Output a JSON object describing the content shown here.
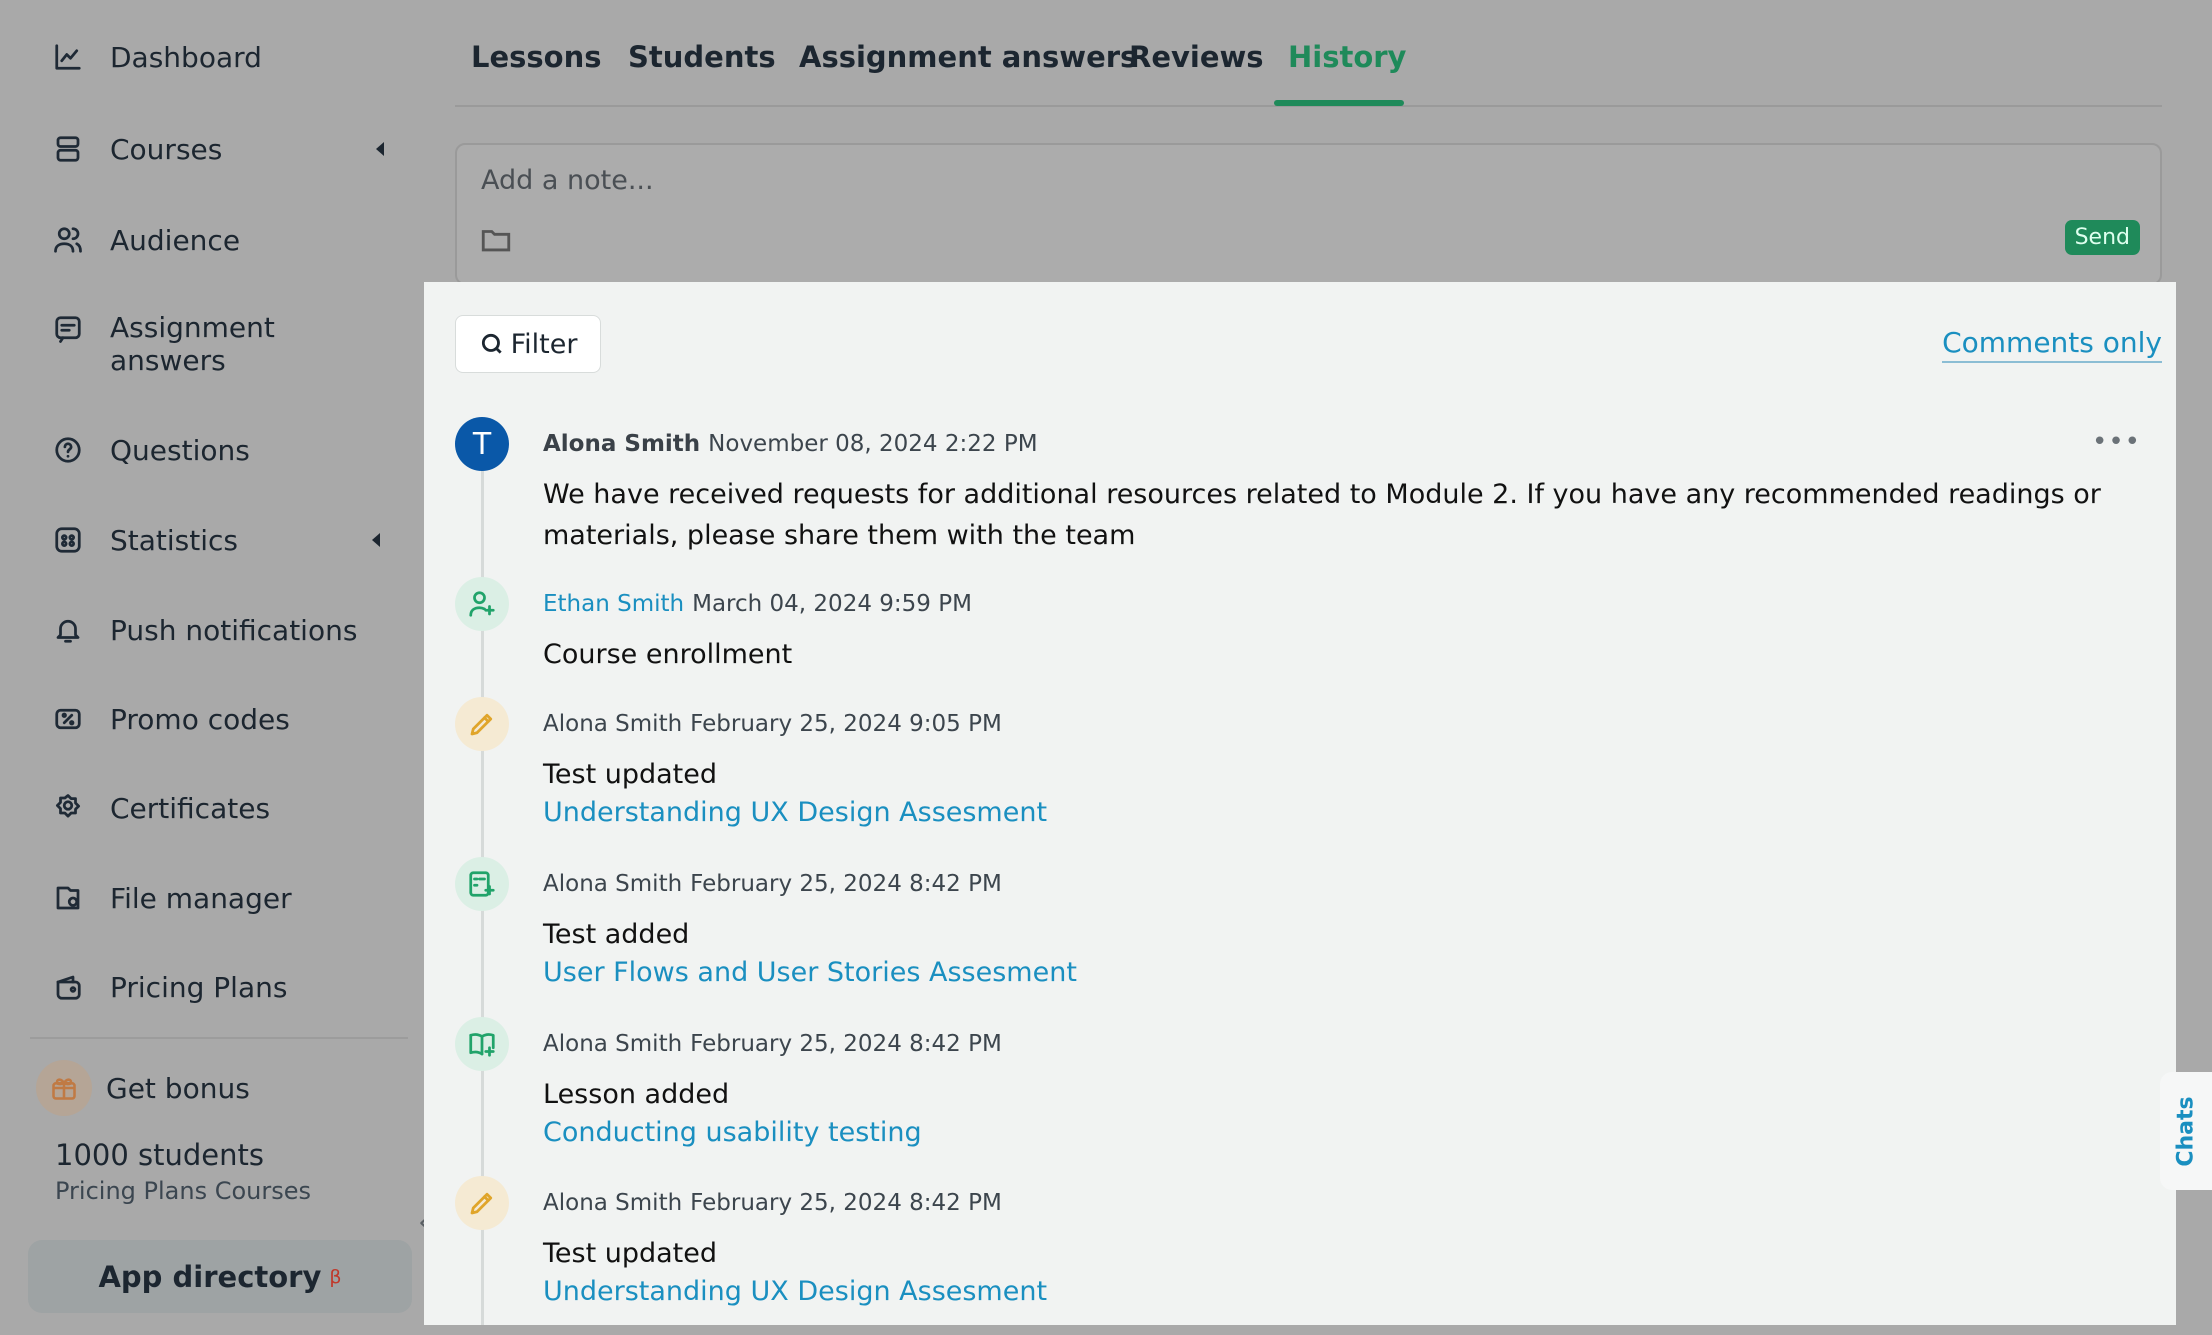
{
  "sidebar": {
    "items": [
      {
        "label": "Dashboard",
        "icon": "chart-line-icon"
      },
      {
        "label": "Courses",
        "icon": "stack-icon"
      },
      {
        "label": "Audience",
        "icon": "users-icon"
      },
      {
        "label": "Assignment answers",
        "icon": "assignment-icon"
      },
      {
        "label": "Questions",
        "icon": "question-icon"
      },
      {
        "label": "Statistics",
        "icon": "statistics-icon"
      },
      {
        "label": "Push notifications",
        "icon": "bell-icon"
      },
      {
        "label": "Promo codes",
        "icon": "promo-icon"
      },
      {
        "label": "Certificates",
        "icon": "certificate-icon"
      },
      {
        "label": "File manager",
        "icon": "file-manager-icon"
      },
      {
        "label": "Pricing Plans",
        "icon": "wallet-icon"
      }
    ],
    "bonus_label": "Get bonus",
    "plan_count": "1000 students",
    "plan_name": "Pricing Plans Courses",
    "app_directory": "App directory",
    "app_directory_badge": "β"
  },
  "tabs": [
    "Lessons",
    "Students",
    "Assignment answers",
    "Reviews",
    "History"
  ],
  "active_tab": "History",
  "note": {
    "placeholder": "Add a note...",
    "send_label": "Send"
  },
  "history": {
    "filter_label": "Filter",
    "comments_only_label": "Comments only",
    "entries": [
      {
        "author": "Alona Smith",
        "date": "November 08, 2024 2:22 PM",
        "text": "We have received requests for additional resources related to Module 2. If you have any recommended readings or materials, please share them with the team",
        "avatar_letter": "T"
      },
      {
        "author": "Ethan Smith",
        "date": "March 04, 2024 9:59 PM",
        "text": "Course enrollment",
        "icon": "user-plus-icon"
      },
      {
        "author": "Alona Smith",
        "date": "February 25, 2024 9:05 PM",
        "text": "Test updated",
        "link": "Understanding UX Design Assesment",
        "icon": "pencil-icon"
      },
      {
        "author": "Alona Smith",
        "date": "February 25, 2024 8:42 PM",
        "text": "Test added",
        "link": "User Flows and User Stories Assesment",
        "icon": "test-add-icon"
      },
      {
        "author": "Alona Smith",
        "date": "February 25, 2024 8:42 PM",
        "text": "Lesson added",
        "link": "Conducting usability testing",
        "icon": "book-add-icon"
      },
      {
        "author": "Alona Smith",
        "date": "February 25, 2024 8:42 PM",
        "text": "Test updated",
        "link": "Understanding UX Design Assesment",
        "icon": "pencil-icon"
      }
    ]
  },
  "chats_label": "Chats",
  "colors": {
    "accent_green": "#1f8a5a",
    "link_blue": "#1a8fc0",
    "avatar_blue": "#0a58a8"
  }
}
